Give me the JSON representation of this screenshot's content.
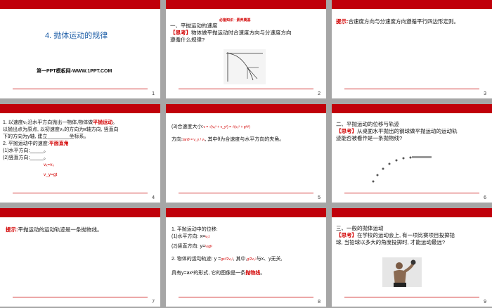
{
  "slides": [
    {
      "num": "1",
      "title_num": "4.",
      "title": "抛体运动的规律",
      "subtitle": "第一PPT模板网-WWW.1PPT.COM"
    },
    {
      "num": "2",
      "banner": "必备知识 · 素养奠基",
      "heading": "一、平抛运动的速度",
      "think_tag": "【思考】",
      "think_l1": "物体做平抛运动时合速度方向与分速度方向",
      "think_l2": "遵循什么规律?"
    },
    {
      "num": "3",
      "hint_tag": "提示:",
      "hint": "合速度方向与分速度方向遵循平行四边形定则。"
    },
    {
      "num": "4",
      "l1a": "1. 以速度v₀沿水平方向抛出一物体,物体做",
      "l1b": "平抛运动",
      "l1c": "。",
      "l2": "以抛出点为原点, 以初速度v₀的方向为x轴方向, 竖直向",
      "l3": "下的方向为y轴, 建立________坐标系。",
      "l4a": "2. 平抛运动中的速度:",
      "l4b": "平面直角",
      "l5": "(1)水平方向:_____。",
      "l6": "(2)竖直方向:_____。",
      "vx": "vₓ=v₀",
      "vy": "v_y=gt"
    },
    {
      "num": "5",
      "l1": "(3)合速度大小:",
      "f1": "v = √(vₓ² + v_y²) = √(v₀² + g²t²)",
      "l2": "方向:",
      "f2": "tanθ = v_y / vₓ",
      "l2b": ", 其中θ为合速度与水平方向的夹角。"
    },
    {
      "num": "6",
      "heading": "二、平抛运动的位移与轨迹",
      "think_tag": "【思考】",
      "think_l1": "从桌面水平抛出的钢球做平抛运动的运动轨",
      "think_l2": "迹能否被看作是一条抛物线?"
    },
    {
      "num": "7",
      "hint_tag": "提示:",
      "hint": "平抛运动的运动轨迹是一条抛物线。"
    },
    {
      "num": "8",
      "l1": "1. 平抛运动中的位移:",
      "l2": "(1)水平方向: x=",
      "f2": "v₀t",
      "l3": "(2)竖直方向: y=",
      "f3": "½gt²",
      "l4a": "2. 物体的运动轨迹: y =",
      "f4": "gx²/2v₀²",
      "l4b": ", 其中,",
      "f4b": "g/2v₀²",
      "l4c": "与x、y无关,",
      "l5a": "具有y=ax²的形式, 它的图像是一条",
      "l5b": "抛物线",
      "l5c": "。"
    },
    {
      "num": "9",
      "heading": "三、一般的抛体运动",
      "think_tag": "【思考】",
      "think_l1": "在学校的运动会上, 有一项比赛项目投掷铅",
      "think_l2": "球, 当铅球以多大的角度投掷时, 才能运动最远?"
    }
  ],
  "colors": {
    "accent": "#c0000a",
    "text_red": "#d20000",
    "blue": "#1f5fa8"
  }
}
